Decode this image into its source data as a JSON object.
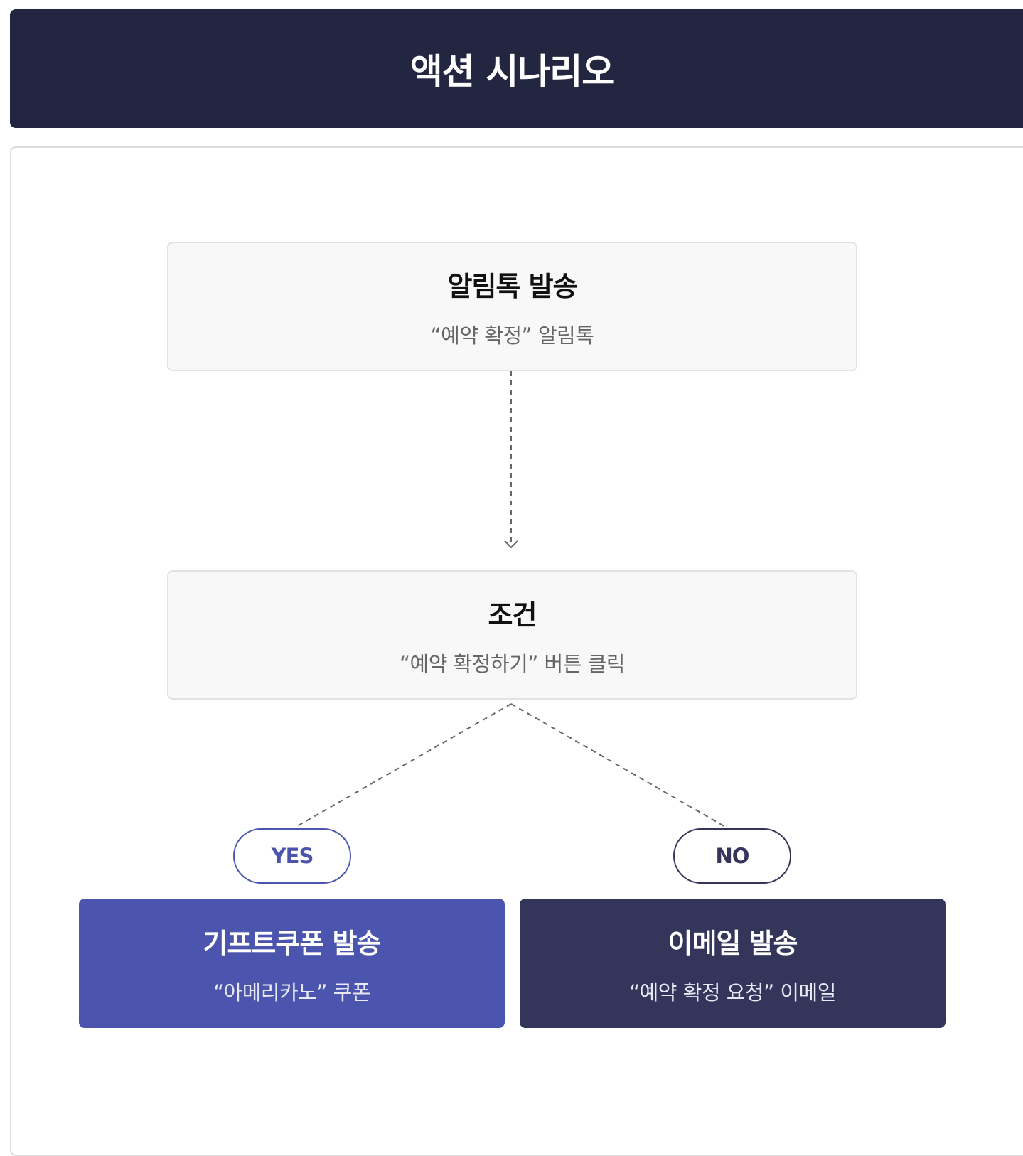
{
  "header": {
    "title": "액션 시나리오"
  },
  "flow": {
    "step1": {
      "title": "알림톡 발송",
      "subtitle": "“예약 확정” 알림톡"
    },
    "condition": {
      "title": "조건",
      "subtitle": "“예약 확정하기” 버튼 클릭"
    },
    "branches": {
      "yes": {
        "label": "YES",
        "title": "기프트쿠폰 발송",
        "subtitle": "“아메리카노” 쿠폰"
      },
      "no": {
        "label": "NO",
        "title": "이메일 발송",
        "subtitle": "“예약 확정 요청” 이메일"
      }
    }
  },
  "colors": {
    "header_bg": "#232641",
    "yes_accent": "#4c55ad",
    "no_accent": "#33355a",
    "node_bg": "#f8f8f8"
  }
}
